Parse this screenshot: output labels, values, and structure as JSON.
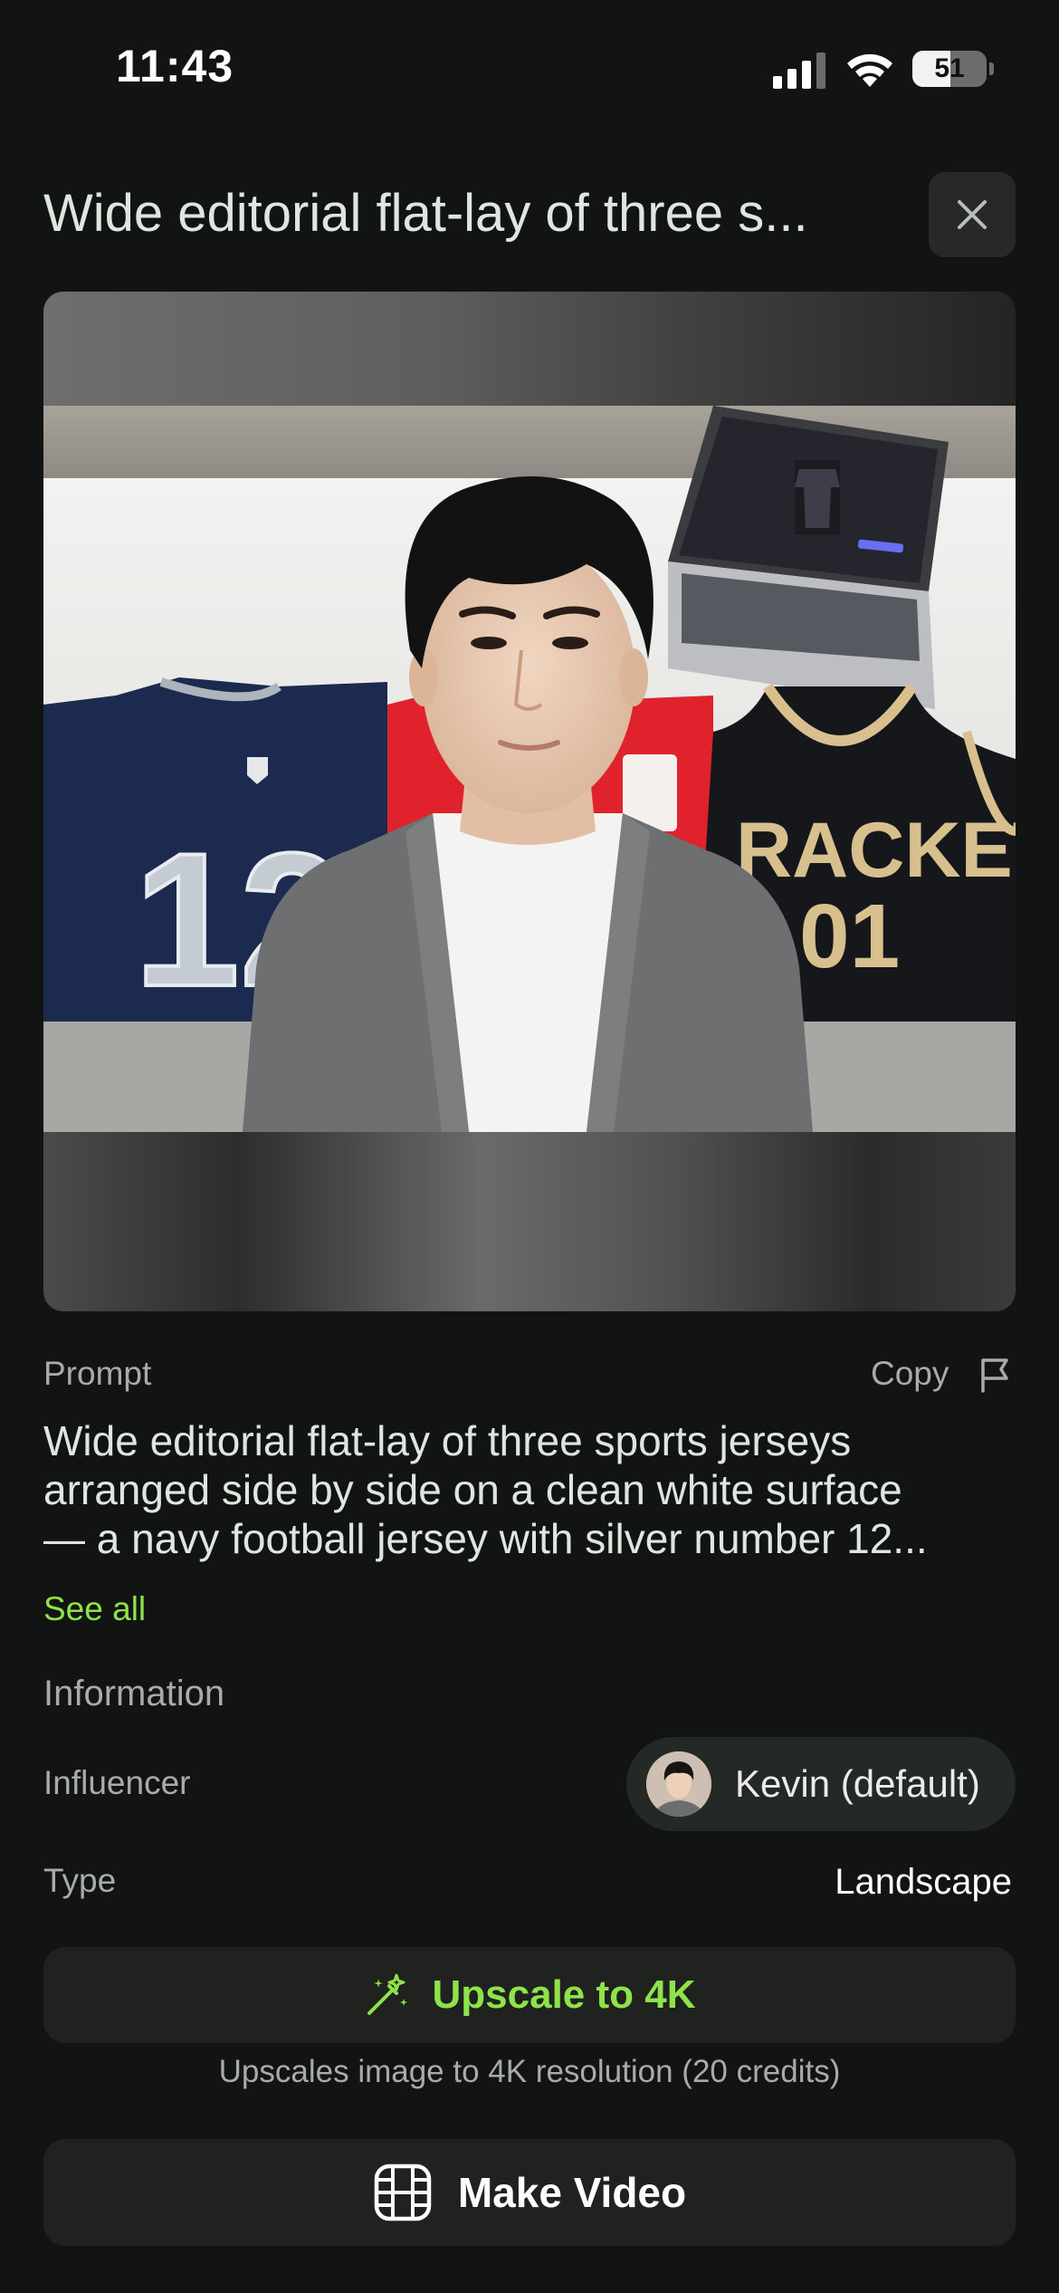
{
  "status_bar": {
    "time": "11:43",
    "battery": "51"
  },
  "header": {
    "title": "Wide editorial flat-lay of three s..."
  },
  "image": {
    "jersey_left_number": "12",
    "jersey_right_text": "RACKETS",
    "jersey_right_number": "01"
  },
  "prompt": {
    "label": "Prompt",
    "copy_label": "Copy",
    "lines": [
      "Wide editorial flat-lay of three sports jerseys",
      "arranged side by side on a clean white surface",
      "— a navy football jersey with silver number 12..."
    ],
    "see_all": "See all"
  },
  "information": {
    "heading": "Information",
    "influencer_label": "Influencer",
    "influencer_name": "Kevin (default)",
    "type_label": "Type",
    "type_value": "Landscape"
  },
  "actions": {
    "upscale_label": "Upscale to 4K",
    "upscale_note": "Upscales image to 4K resolution (20 credits)",
    "video_label": "Make Video"
  },
  "colors": {
    "background": "#121413",
    "accent_green": "#8fe34a",
    "surface": "#1f221f"
  },
  "icons": {
    "close": "close-icon",
    "flag": "flag-icon",
    "upscale": "magic-wand-icon",
    "video": "film-icon"
  }
}
